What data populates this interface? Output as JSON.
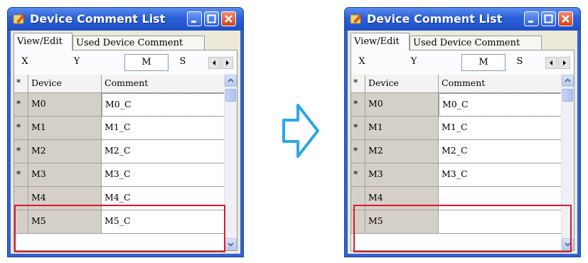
{
  "window_title": "Device Comment List",
  "tabs": [
    "View/Edit",
    "Used Device Comment"
  ],
  "device_types": [
    "X",
    "Y",
    "M",
    "S"
  ],
  "selected_type": "M",
  "columns": {
    "mark": "*",
    "device": "Device",
    "comment": "Comment"
  },
  "before": {
    "rows": [
      {
        "mark": "*",
        "device": "M0",
        "comment": "M0_C"
      },
      {
        "mark": "*",
        "device": "M1",
        "comment": "M1_C"
      },
      {
        "mark": "*",
        "device": "M2",
        "comment": "M2_C"
      },
      {
        "mark": "*",
        "device": "M3",
        "comment": "M3_C"
      },
      {
        "mark": "",
        "device": "M4",
        "comment": "M4_C"
      },
      {
        "mark": "",
        "device": "M5",
        "comment": "M5_C"
      }
    ]
  },
  "after": {
    "rows": [
      {
        "mark": "*",
        "device": "M0",
        "comment": "M0_C"
      },
      {
        "mark": "*",
        "device": "M1",
        "comment": "M1_C"
      },
      {
        "mark": "*",
        "device": "M2",
        "comment": "M2_C"
      },
      {
        "mark": "*",
        "device": "M3",
        "comment": "M3_C"
      },
      {
        "mark": "",
        "device": "M4",
        "comment": ""
      },
      {
        "mark": "",
        "device": "M5",
        "comment": ""
      }
    ]
  },
  "colors": {
    "highlight": "#e2142a",
    "arrow_fill": "#ffffff",
    "arrow_stroke": "#2aa7e8",
    "titlebar": "#2a5fd8"
  }
}
